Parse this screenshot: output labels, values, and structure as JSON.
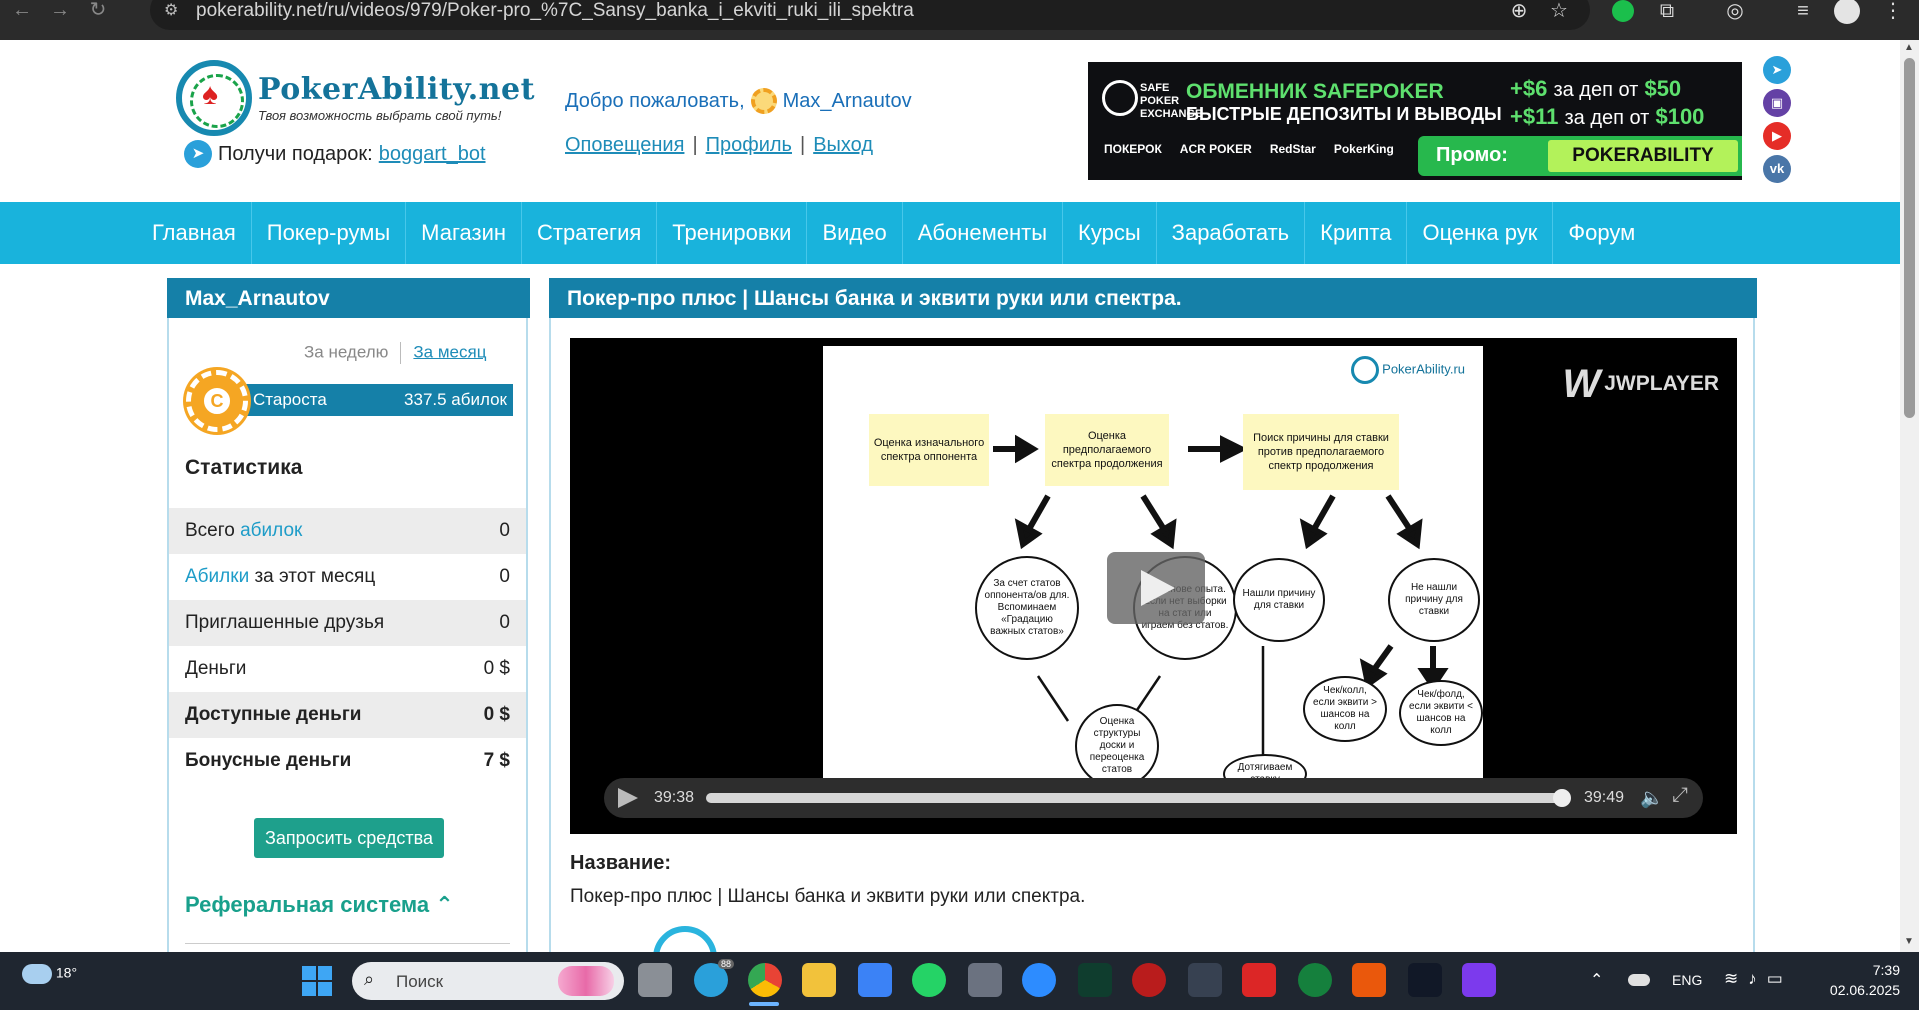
{
  "browser": {
    "url": "pokerability.net/ru/videos/979/Poker-pro_%7C_Sansy_banka_i_ekviti_ruki_ili_spektra",
    "back_icon": "arrow-left-icon",
    "forward_icon": "arrow-right-icon",
    "reload_icon": "reload-icon"
  },
  "header": {
    "logo_title": "PokerAbility.net",
    "logo_tagline": "Твоя возможность выбрать свой путь!",
    "gift_text": "Получи подарок:",
    "gift_link": "boggart_bot",
    "welcome_text": "Добро пожаловать,",
    "username": "Max_Arnautov",
    "links": {
      "notifications": "Оповещения",
      "profile": "Профиль",
      "logout": "Выход"
    }
  },
  "banner": {
    "logo_text": "SAFE POKER EXCHANGE",
    "line1": "ОБМЕННИК SAFEPOKER",
    "line2": "БЫСТРЫЕ ДЕПОЗИТЫ И ВЫВОДЫ",
    "bonus1_amount": "+$6",
    "bonus1_text": "за деп от",
    "bonus1_min": "$50",
    "bonus2_amount": "+$11",
    "bonus2_text": "за деп от",
    "bonus2_min": "$100",
    "partners": [
      "ПОКЕРОК",
      "ACR POKER",
      "RedStar",
      "PokerKing"
    ],
    "promo_label": "Промо:",
    "promo_code": "POKERABILITY"
  },
  "nav": {
    "items": [
      "Главная",
      "Покер-румы",
      "Магазин",
      "Стратегия",
      "Тренировки",
      "Видео",
      "Абонементы",
      "Курсы",
      "Заработать",
      "Крипта",
      "Оценка рук",
      "Форум"
    ]
  },
  "sidebar": {
    "username": "Max_Arnautov",
    "tab_week": "За неделю",
    "tab_month": "За месяц",
    "rank_letter": "C",
    "rank_name": "Староста",
    "rank_value": "337.5 абилок",
    "stats_title": "Статистика",
    "stats": {
      "total_prefix": "Всего",
      "total_hl": "абилок",
      "total_value": "0",
      "month_hl": "Абилки",
      "month_suffix": "за этот месяц",
      "month_value": "0",
      "friends_label": "Приглашенные друзья",
      "friends_value": "0",
      "money_label": "Деньги",
      "money_value": "0 $",
      "available_label": "Доступные деньги",
      "available_value": "0 $",
      "bonus_label": "Бонусные деньги",
      "bonus_value": "7 $"
    },
    "withdraw_button": "Запросить средства",
    "referral_title": "Реферальная система"
  },
  "video": {
    "page_title": "Покер-про плюс | Шансы банка и эквити руки или спектра.",
    "player_brand": "JWPLAYER",
    "time_current": "39:38",
    "time_total": "39:49",
    "progress_fraction": 0.995,
    "name_label": "Название:",
    "name_value": "Покер-про плюс | Шансы банка и эквити руки или спектра.",
    "slide": {
      "brand": "PokerAbility.ru",
      "box1": "Оценка изначального спектра оппонента",
      "box2": "Оценка предполагаемого спектра продолжения",
      "box3": "Поиск причины для ставки против предполагаемого спектр продолжения",
      "cloud1": "За счет статов оппонента/ов для. Вспоминаем «Градацию важных статов»",
      "cloud2": "На основе опыта. Если нет выборки на стат или играем без статов.",
      "cloud3": "Нашли причину для ставки",
      "cloud4": "Не нашли причину для ставки",
      "cloud5": "Оценка структуры доски и переоценка статов",
      "cloud6": "Чек/колл, если эквити > шансов на колл",
      "cloud7": "Чек/фолд, если эквити < шансов на колл",
      "cloud8": "Дотягиваем ставку"
    }
  },
  "taskbar": {
    "temperature": "18°",
    "search_placeholder": "Поиск",
    "telegram_badge": "88",
    "language": "ENG",
    "time": "7:39",
    "date": "02.06.2025"
  }
}
